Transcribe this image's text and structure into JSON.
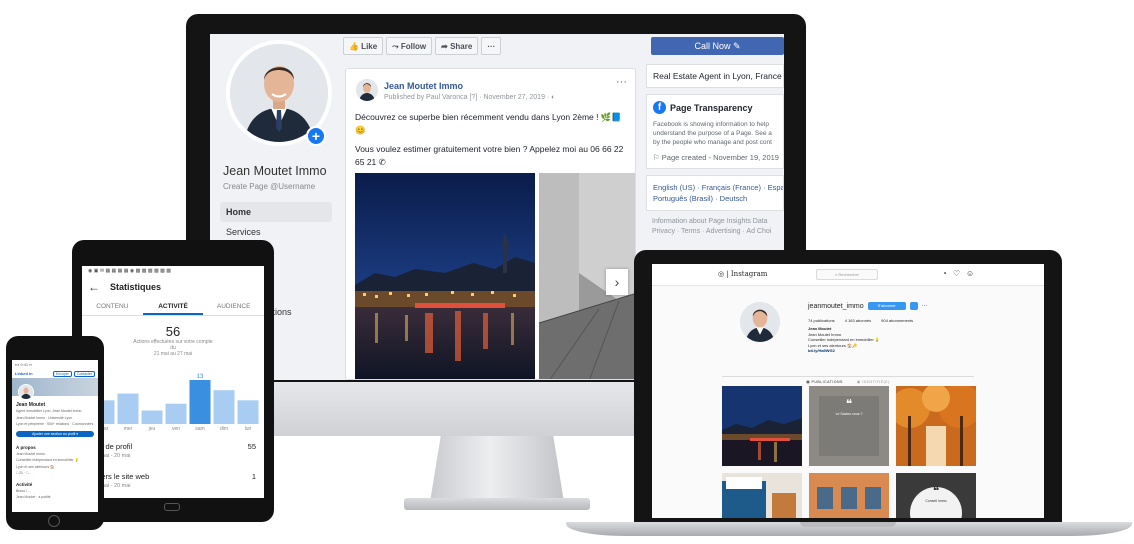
{
  "facebook": {
    "page_name": "Jean Moutet Immo",
    "username": "Create Page @Username",
    "nav": [
      "Home",
      "Services",
      "",
      "",
      "",
      "motions"
    ],
    "toolbar": {
      "like": "👍 Like",
      "follow": "⤳ Follow",
      "share": "➦ Share",
      "more": "···"
    },
    "call_now": "Call Now ✎",
    "post": {
      "author": "Jean Moutet Immo",
      "meta": "Published by Paul Varonca [?] · November 27, 2019 · ◐",
      "more": "···",
      "line1": "Découvrez ce superbe bien récemment vendu dans Lyon 2ème ! 🌿📘😊",
      "line2": "Vous voulez estimer gratuitement votre bien ? Appelez moi au 06 66 22 65 21 ✆",
      "next_arrow": "›"
    },
    "right": {
      "about": "Real Estate Agent in Lyon, France",
      "transparency_title": "Page Transparency",
      "transparency_text": [
        "Facebook is showing information to help",
        "understand the purpose of a Page. See a",
        "by the people who manage and post cont"
      ],
      "page_created": "⚐ Page created - November 19, 2019",
      "languages": [
        "English (US) · Français (France) · Espa",
        "Português (Brasil) · Deutsch"
      ],
      "footer": [
        "Information about Page Insights Data",
        "Privacy · Terms · Advertising · Ad Choi"
      ]
    }
  },
  "tablet": {
    "status": "◉ ▣ ✉ ▦ ▦ ▦ ▦       ◉ ▩ ▩ ▩ ▩ ▩ ▩",
    "back": "←",
    "title": "Statistiques",
    "tabs": [
      "CONTENU",
      "ACTIVITÉ",
      "AUDIENCE"
    ],
    "total": "56",
    "total_label": "Actions effectuées sur votre compte",
    "total_sub": "du",
    "range": "21 mai au 27 mai",
    "chart_days": [
      "mar",
      "mer",
      "jeu",
      "ven",
      "sam",
      "dim",
      "lun"
    ],
    "chart_values": [
      7,
      9,
      4,
      6,
      13,
      10,
      7
    ],
    "chart_top_label": "13",
    "rows": [
      {
        "title": "sites de profil",
        "value": "55",
        "sub": "u 14 mai - 20 mai"
      },
      {
        "title": "cs vers le site web",
        "value": "1",
        "sub": "u 14 mai - 20 mai"
      }
    ]
  },
  "phone": {
    "status": "▪▪▪    9:41    ▪▪",
    "logo": "Linked in",
    "btn1": "Envoyer",
    "btn2": "Contacter",
    "name": "Jean Moutet",
    "headline": [
      "Agent immobilier Lyon, Jean Moutet Immo",
      "Jean Moutet Immo · Université Lyon",
      "Lyon et périphérie · 500+ relations · Coordonnées"
    ],
    "cta": "Ajouter une section au profil ▾",
    "about_title": "À propos",
    "about_text": [
      "Jean Moutet Immo",
      "Conseiller indépendant en immobilier 💡",
      "Lyon et ses alentours 🏠",
      "□ 21 · □ …"
    ],
    "activity_title": "Activité",
    "activity_text": [
      "Bravo ! …",
      "Jean Moutet · a publié"
    ]
  },
  "instagram": {
    "logo": "◎ | Instagram",
    "search": "⌕ Rechercher",
    "icons": [
      "◔",
      "♡",
      "☺"
    ],
    "username": "jeanmoutet_immo",
    "follow": "S'abonner",
    "more": "···",
    "stats": [
      "74 publications",
      "4 163 abonnés",
      "904 abonnements"
    ],
    "bio": [
      "Jean Moutet",
      "Jean Moutet Immo",
      "Conseiller indépendant en immobilier 💡",
      "Lyon et ses alentours 🏠🔑"
    ],
    "bio_link": "bit.ly/Ha9WG2",
    "tabs": [
      "▦ PUBLICATIONS",
      "▣ IDENTIFIÉ(E)"
    ],
    "tile2_text": "Le Saviez-vous ?",
    "tile6_text": "Conseil immo"
  }
}
